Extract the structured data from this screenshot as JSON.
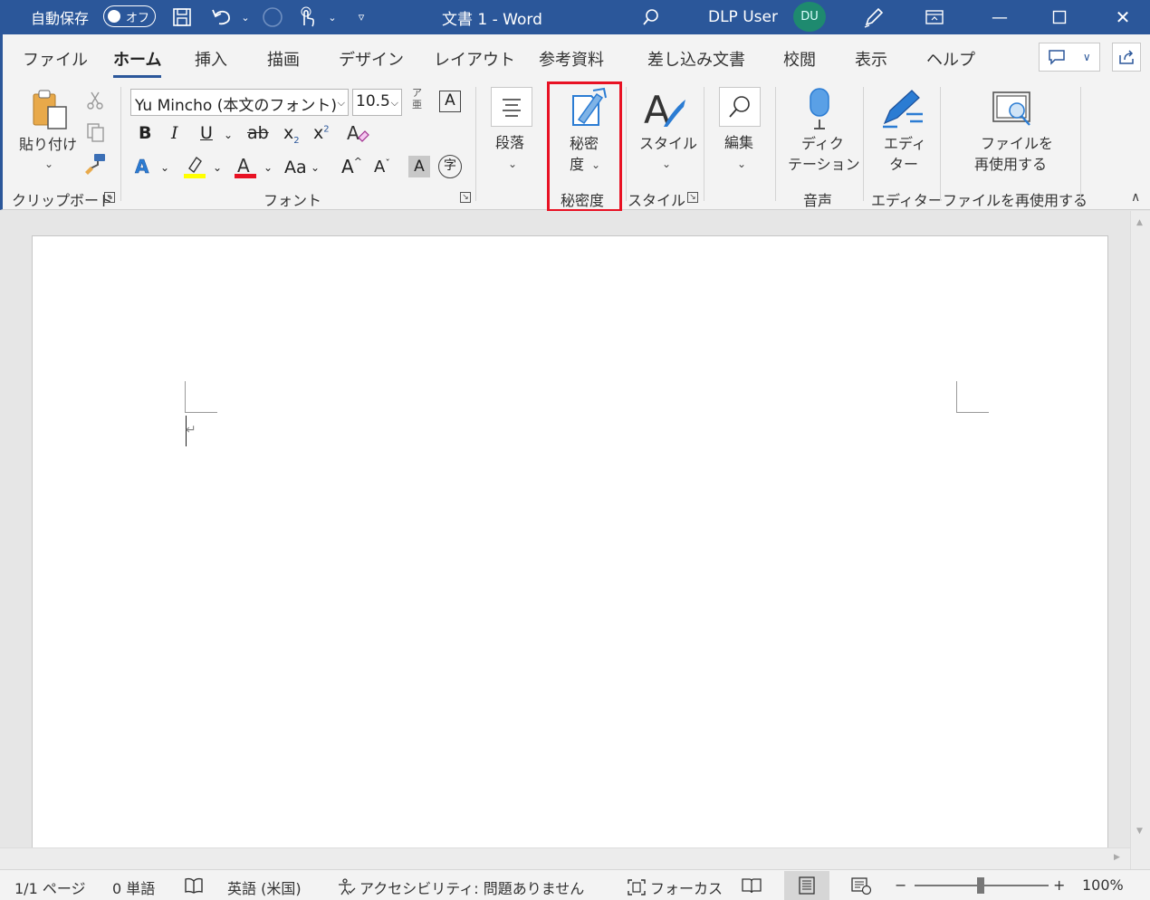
{
  "titlebar": {
    "autosave_label": "自動保存",
    "autosave_state": "オフ",
    "doc_title": "文書 1  -  Word",
    "user_name": "DLP User",
    "user_initials": "DU",
    "accent": "#2b579a",
    "icons": [
      "save-icon",
      "undo-icon",
      "redo-icon",
      "touch-mode-icon",
      "customize-qat-icon",
      "search-icon",
      "pen-icon",
      "ribbon-display-icon",
      "minimize-icon",
      "maximize-icon",
      "close-icon"
    ]
  },
  "tabs": [
    "ファイル",
    "ホーム",
    "挿入",
    "描画",
    "デザイン",
    "レイアウト",
    "参考資料",
    "差し込み文書",
    "校閲",
    "表示",
    "ヘルプ"
  ],
  "active_tab": "ホーム",
  "ribbon": {
    "clipboard": {
      "paste_label": "貼り付け",
      "group_label": "クリップボード"
    },
    "font": {
      "font_name": "Yu Mincho (本文のフォント)",
      "font_size": "10.5",
      "phonetic_label": "ア\n亜",
      "bold": "B",
      "italic": "I",
      "underline": "U",
      "strike": "ab",
      "subscript": "x",
      "sub_digit": "2",
      "superscript": "x",
      "sup_digit": "2",
      "text_effects": "A",
      "font_color": "A",
      "change_case": "Aa",
      "grow_font": "A",
      "shrink_font": "A",
      "char_shading": "A",
      "enclose_char": "字",
      "group_label": "フォント",
      "highlight_color": "#ffff00",
      "font_color_hex": "#ff0000"
    },
    "paragraph": {
      "label": "段落"
    },
    "sensitivity": {
      "label_line1": "秘密",
      "label_line2": "度",
      "group_label": "秘密度"
    },
    "styles": {
      "label": "スタイル",
      "group_label": "スタイル"
    },
    "editing": {
      "label": "編集"
    },
    "voice": {
      "label_line1": "ディク",
      "label_line2": "テーション",
      "group_label": "音声"
    },
    "editor": {
      "label_line1": "エディ",
      "label_line2": "ター",
      "group_label": "エディター"
    },
    "reuse": {
      "label_line1": "ファイルを",
      "label_line2": "再使用する",
      "group_label": "ファイルを再使用する"
    },
    "highlight_color": "#e81123"
  },
  "statusbar": {
    "page": "1/1 ページ",
    "words": "0 単語",
    "language": "英語 (米国)",
    "accessibility": "アクセシビリティ: 問題ありません",
    "focus": "フォーカス",
    "zoom_minus": "−",
    "zoom_plus": "+",
    "zoom": "100%"
  }
}
